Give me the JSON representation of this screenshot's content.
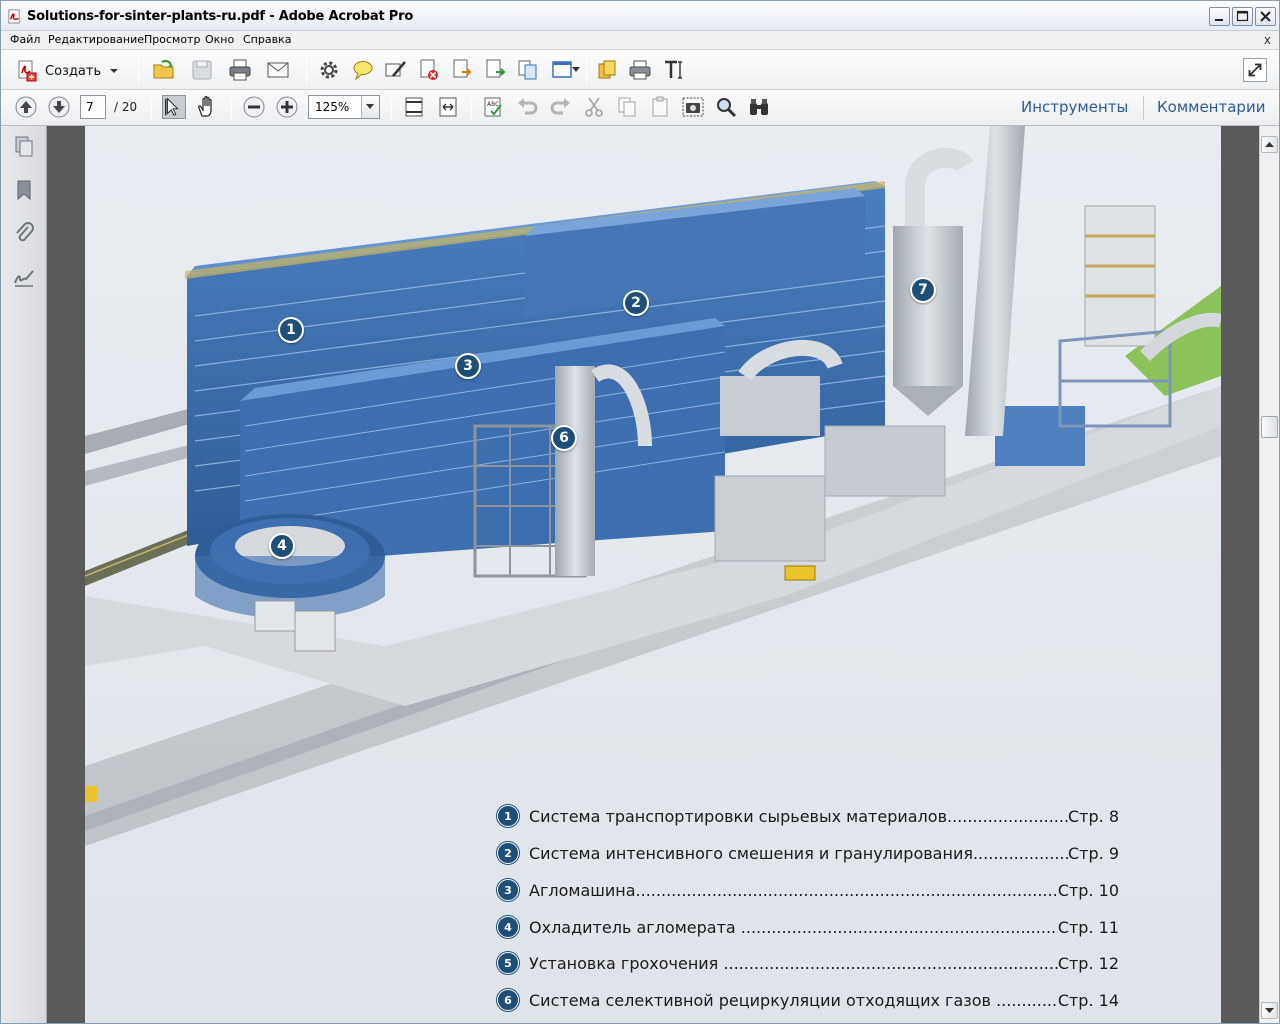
{
  "window": {
    "title": "Solutions-for-sinter-plants-ru.pdf - Adobe Acrobat Pro"
  },
  "menu": {
    "items": [
      "Файл",
      "Редактирование",
      "Просмотр",
      "Окно",
      "Справка"
    ],
    "close": "x"
  },
  "toolbar": {
    "create_label": "Создать"
  },
  "nav": {
    "current_page": "7",
    "total_pages": "/  20",
    "zoom": "125%"
  },
  "panels": {
    "tools": "Инструменты",
    "comments": "Комментарии"
  },
  "figure": {
    "callouts": [
      "1",
      "2",
      "3",
      "4",
      "6",
      "7"
    ]
  },
  "toc": [
    {
      "num": "1",
      "text": "Система транспортировки сырьевых материалов",
      "page": "Стр. 8"
    },
    {
      "num": "2",
      "text": "Система интенсивного смешения и гранулирования",
      "page": "Стр. 9"
    },
    {
      "num": "3",
      "text": "Агломашина",
      "page": "Стр. 10"
    },
    {
      "num": "4",
      "text": "Охладитель агломерата ",
      "page": "Стр. 11"
    },
    {
      "num": "5",
      "text": "Установка грохочения ",
      "page": "Стр. 12"
    },
    {
      "num": "6",
      "text": "Система селективной рециркуляции отходящих газов ",
      "page": "Стр. 14"
    }
  ],
  "colors": {
    "accent": "#1d4f78",
    "plant_blue": "#3b6fb0",
    "link": "#2d5a9a"
  }
}
